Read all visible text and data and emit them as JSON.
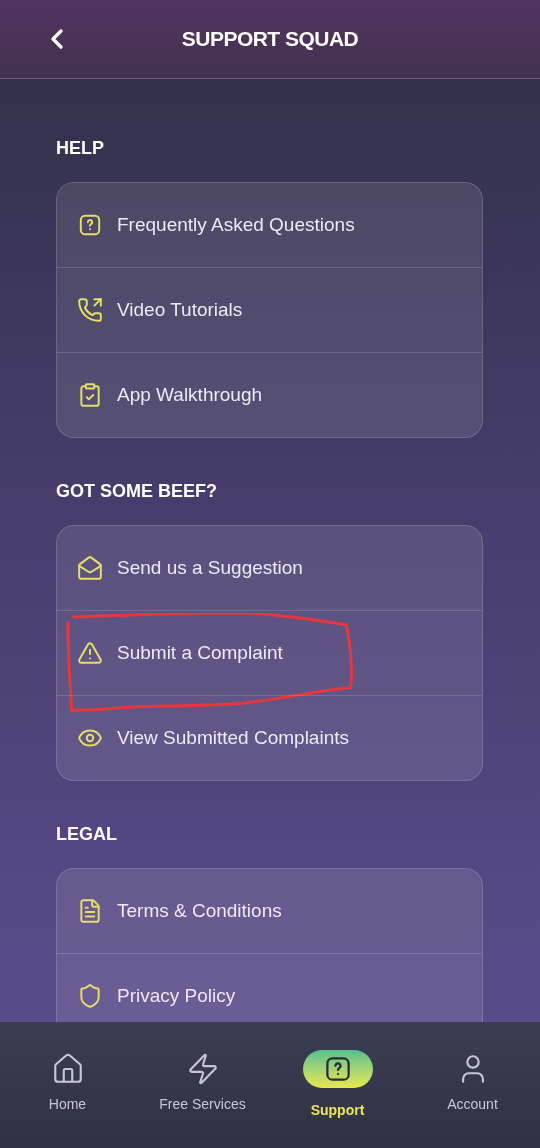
{
  "header": {
    "title": "SUPPORT SQUAD"
  },
  "sections": [
    {
      "heading": "HELP",
      "items": [
        {
          "label": "Frequently Asked Questions",
          "highlighted": false
        },
        {
          "label": "Video Tutorials",
          "highlighted": false
        },
        {
          "label": "App Walkthrough",
          "highlighted": false
        }
      ]
    },
    {
      "heading": "GOT SOME BEEF?",
      "items": [
        {
          "label": "Send us a Suggestion",
          "highlighted": false
        },
        {
          "label": "Submit a Complaint",
          "highlighted": true
        },
        {
          "label": "View Submitted Complaints",
          "highlighted": false
        }
      ]
    },
    {
      "heading": "LEGAL",
      "items": [
        {
          "label": "Terms & Conditions",
          "highlighted": false
        },
        {
          "label": "Privacy Policy",
          "highlighted": false
        }
      ]
    }
  ],
  "bottom_nav": [
    {
      "label": "Home",
      "selected": false
    },
    {
      "label": "Free Services",
      "selected": false
    },
    {
      "label": "Support",
      "selected": true
    },
    {
      "label": "Account",
      "selected": false
    }
  ]
}
